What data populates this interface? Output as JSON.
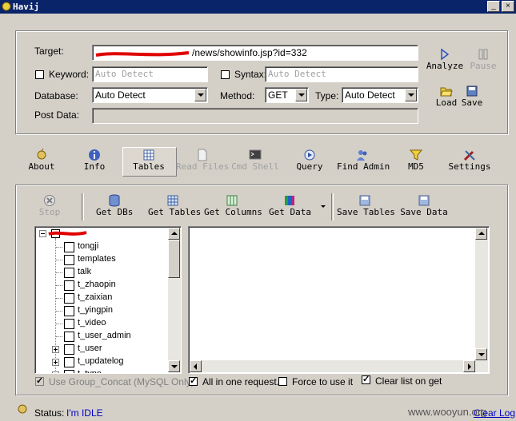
{
  "window": {
    "title": "Havij",
    "minimize": "_",
    "close": "×"
  },
  "target": {
    "target_label": "Target:",
    "target_value": "/news/showinfo.jsp?id=332",
    "keyword_label": "Keyword:",
    "keyword_placeholder": "Auto Detect",
    "syntax_label": "Syntax:",
    "syntax_placeholder": "Auto Detect",
    "database_label": "Database:",
    "database_value": "Auto Detect",
    "method_label": "Method:",
    "method_value": "GET",
    "type_label": "Type:",
    "type_value": "Auto Detect",
    "postdata_label": "Post Data:",
    "analyze": "Analyze",
    "pause": "Pause",
    "load": "Load",
    "save": "Save"
  },
  "main_toolbar": [
    {
      "label": "About",
      "icon": "about-icon",
      "disabled": false
    },
    {
      "label": "Info",
      "icon": "info-icon",
      "disabled": false
    },
    {
      "label": "Tables",
      "icon": "tables-icon",
      "disabled": false,
      "active": true
    },
    {
      "label": "Read Files",
      "icon": "file-icon",
      "disabled": true
    },
    {
      "label": "Cmd Shell",
      "icon": "terminal-icon",
      "disabled": true
    },
    {
      "label": "Query",
      "icon": "query-icon",
      "disabled": false
    },
    {
      "label": "Find Admin",
      "icon": "users-icon",
      "disabled": false
    },
    {
      "label": "MD5",
      "icon": "funnel-icon",
      "disabled": false
    },
    {
      "label": "Settings",
      "icon": "tools-icon",
      "disabled": false
    }
  ],
  "tables_toolbar": {
    "stop": "Stop",
    "get_dbs": "Get DBs",
    "get_tables": "Get Tables",
    "get_columns": "Get Columns",
    "get_data": "Get Data",
    "save_tables": "Save Tables",
    "save_data": "Save Data"
  },
  "tree": {
    "items": [
      {
        "label": "tongji",
        "expandable": false
      },
      {
        "label": "templates",
        "expandable": false
      },
      {
        "label": "talk",
        "expandable": false
      },
      {
        "label": "t_zhaopin",
        "expandable": false
      },
      {
        "label": "t_zaixian",
        "expandable": false
      },
      {
        "label": "t_yingpin",
        "expandable": false
      },
      {
        "label": "t_video",
        "expandable": false
      },
      {
        "label": "t_user_admin",
        "expandable": false
      },
      {
        "label": "t_user",
        "expandable": true
      },
      {
        "label": "t_updatelog",
        "expandable": true
      },
      {
        "label": "t_type",
        "expandable": true
      }
    ]
  },
  "options": {
    "group_concat": "Use Group_Concat (MySQL Only)",
    "all_in_one": "All in one request.",
    "force": "Force to use it",
    "clear_list": "Clear list on get"
  },
  "status": {
    "label": "Status:",
    "value": "I'm IDLE",
    "clear_log": "Clear Log",
    "watermark": "www.wooyun.org"
  },
  "colors": {
    "title_bg": "#0a246a",
    "face": "#d4d0c8",
    "status_value": "#0000c0",
    "redaction": "#e00000"
  }
}
